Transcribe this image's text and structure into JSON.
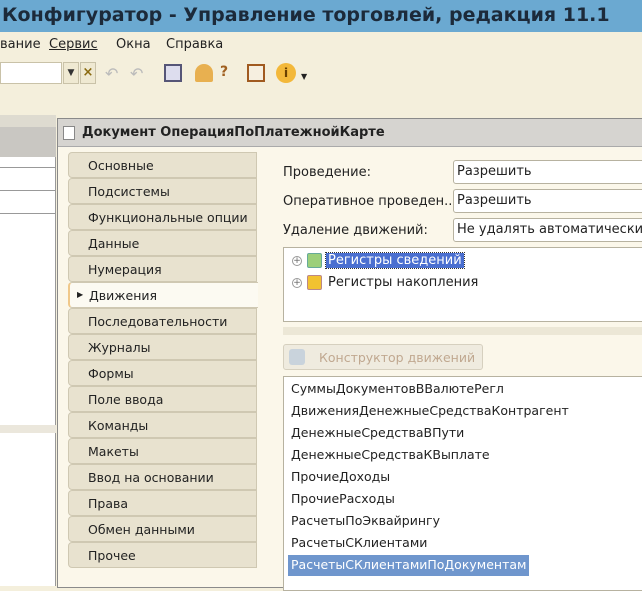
{
  "window": {
    "title": "Конфигуратор - Управление торговлей, редакция 11.1"
  },
  "menu": [
    "вание",
    "Сервис",
    "Окна",
    "Справка"
  ],
  "toolbar": {
    "icons": [
      "dropdown-arrow-icon",
      "clear-icon",
      "back-icon",
      "forward-icon",
      "windows-icon",
      "user-icon",
      "search-help-icon",
      "report-icon",
      "info-icon"
    ]
  },
  "document": {
    "title": "Документ ОперацияПоПлатежнойКарте",
    "tabs": [
      "Основные",
      "Подсистемы",
      "Функциональные опции",
      "Данные",
      "Нумерация",
      "Движения",
      "Последовательности",
      "Журналы",
      "Формы",
      "Поле ввода",
      "Команды",
      "Макеты",
      "Ввод на основании",
      "Права",
      "Обмен данными",
      "Прочее"
    ],
    "selected_tab": "Движения",
    "fields": [
      {
        "label": "Проведение:",
        "value": "Разрешить"
      },
      {
        "label": "Оперативное проведен...",
        "value": "Разрешить"
      },
      {
        "label": "Удаление движений:",
        "value": "Не удалять автоматически"
      }
    ],
    "tree": [
      "Регистры сведений",
      "Регистры накопления"
    ],
    "constructor_button": "Конструктор движений",
    "registers": [
      "СуммыДокументовВВалютеРегл",
      "ДвиженияДенежныеСредстваКонтрагент",
      "ДенежныеСредстваВПути",
      "ДенежныеСредстваКВыплате",
      "ПрочиеДоходы",
      "ПрочиеРасходы",
      "РасчетыПоЭквайрингу",
      "РасчетыСКлиентами",
      "РасчетыСКлиентамиПоДокументам"
    ],
    "selected_register": "РасчетыСКлиентамиПоДокументам"
  },
  "colors": {
    "titlebar": "#6ba9d1",
    "selection": "#6f96cd",
    "tree_selection": "#4a6fd0"
  }
}
